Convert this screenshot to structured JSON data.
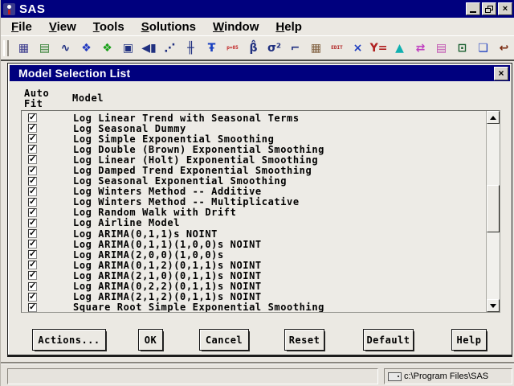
{
  "window": {
    "title": "SAS"
  },
  "menu": {
    "items": [
      "File",
      "View",
      "Tools",
      "Solutions",
      "Window",
      "Help"
    ]
  },
  "toolbar": {
    "icons": [
      {
        "name": "data-table-icon",
        "glyph": "▦",
        "color": "#3a3a8c"
      },
      {
        "name": "properties-list-icon",
        "glyph": "▤",
        "color": "#2f7d2f"
      },
      {
        "name": "time-series-plot-icon",
        "glyph": "∿",
        "color": "#203080"
      },
      {
        "name": "link-diagram-blue-icon",
        "glyph": "❖",
        "color": "#2038c0"
      },
      {
        "name": "link-diagram-green-icon",
        "glyph": "❖",
        "color": "#18a018"
      },
      {
        "name": "submit-calendar-icon",
        "glyph": "▣",
        "color": "#203080"
      },
      {
        "name": "data-import-icon",
        "glyph": "◀▮",
        "color": "#203080"
      },
      {
        "name": "fit-plot-icon",
        "glyph": "⋰",
        "color": "#203080"
      },
      {
        "name": "high-low-plot-icon",
        "glyph": "╫",
        "color": "#203080"
      },
      {
        "name": "t-statistic-icon",
        "glyph": "Ŧ",
        "color": "#1840c0"
      },
      {
        "name": "p-value-icon",
        "glyph": "p=05",
        "color": "#c02020"
      },
      {
        "name": "beta-estimate-icon",
        "glyph": "β̂",
        "color": "#203080"
      },
      {
        "name": "sigma-squared-icon",
        "glyph": "σ²",
        "color": "#203080"
      },
      {
        "name": "step-plot-icon",
        "glyph": "⌐",
        "color": "#203080"
      },
      {
        "name": "data-grid-icon",
        "glyph": "▦",
        "color": "#806040"
      },
      {
        "name": "edit-mode-icon",
        "glyph": "EDIT",
        "color": "#b02020"
      },
      {
        "name": "clear-icon",
        "glyph": "×",
        "color": "#2040c0"
      },
      {
        "name": "fit-equation-icon",
        "glyph": "Y=",
        "color": "#b02020"
      },
      {
        "name": "wizard-icon",
        "glyph": "▲",
        "color": "#10b0b0"
      },
      {
        "name": "transfer-notes-icon",
        "glyph": "⇄",
        "color": "#c040c0"
      },
      {
        "name": "document-review-icon",
        "glyph": "▤",
        "color": "#c050b0"
      },
      {
        "name": "search-data-icon",
        "glyph": "⊡",
        "color": "#1a6030"
      },
      {
        "name": "cascade-windows-icon",
        "glyph": "❏",
        "color": "#2040c0"
      },
      {
        "name": "undo-icon",
        "glyph": "↩",
        "color": "#7a2a10"
      }
    ]
  },
  "dialog": {
    "title": "Model Selection List",
    "close_glyph": "×",
    "check_glyph": "✓",
    "columns": {
      "auto_line1": "Auto",
      "auto_line2": "Fit",
      "model": "Model"
    },
    "models": [
      {
        "checked": true,
        "label": "Log Linear Trend with Seasonal Terms"
      },
      {
        "checked": true,
        "label": "Log Seasonal Dummy"
      },
      {
        "checked": true,
        "label": "Log Simple Exponential Smoothing"
      },
      {
        "checked": true,
        "label": "Log Double (Brown) Exponential Smoothing"
      },
      {
        "checked": true,
        "label": "Log Linear (Holt) Exponential Smoothing"
      },
      {
        "checked": true,
        "label": "Log Damped Trend Exponential Smoothing"
      },
      {
        "checked": true,
        "label": "Log Seasonal Exponential Smoothing"
      },
      {
        "checked": true,
        "label": "Log Winters Method -- Additive"
      },
      {
        "checked": true,
        "label": "Log Winters Method -- Multiplicative"
      },
      {
        "checked": true,
        "label": "Log Random Walk with Drift"
      },
      {
        "checked": true,
        "label": "Log Airline Model"
      },
      {
        "checked": true,
        "label": "Log ARIMA(0,1,1)s NOINT"
      },
      {
        "checked": true,
        "label": "Log ARIMA(0,1,1)(1,0,0)s NOINT"
      },
      {
        "checked": true,
        "label": "Log ARIMA(2,0,0)(1,0,0)s"
      },
      {
        "checked": true,
        "label": "Log ARIMA(0,1,2)(0,1,1)s NOINT"
      },
      {
        "checked": true,
        "label": "Log ARIMA(2,1,0)(0,1,1)s NOINT"
      },
      {
        "checked": true,
        "label": "Log ARIMA(0,2,2)(0,1,1)s NOINT"
      },
      {
        "checked": true,
        "label": "Log ARIMA(2,1,2)(0,1,1)s NOINT"
      },
      {
        "checked": true,
        "label": "Square Root Simple Exponential Smoothing"
      }
    ],
    "buttons": [
      {
        "name": "actions-button",
        "label": "Actions..."
      },
      {
        "name": "ok-button",
        "label": "OK"
      },
      {
        "name": "cancel-button",
        "label": "Cancel"
      },
      {
        "name": "reset-button",
        "label": "Reset"
      },
      {
        "name": "default-button",
        "label": "Default"
      },
      {
        "name": "help-button",
        "label": "Help"
      }
    ]
  },
  "statusbar": {
    "left_text": "",
    "path": "c:\\Program Files\\SAS"
  },
  "colors": {
    "titlebar_bg": "#00007e",
    "chrome_bg": "#ebe8e2",
    "dialog_bg": "#ebe9e3"
  }
}
